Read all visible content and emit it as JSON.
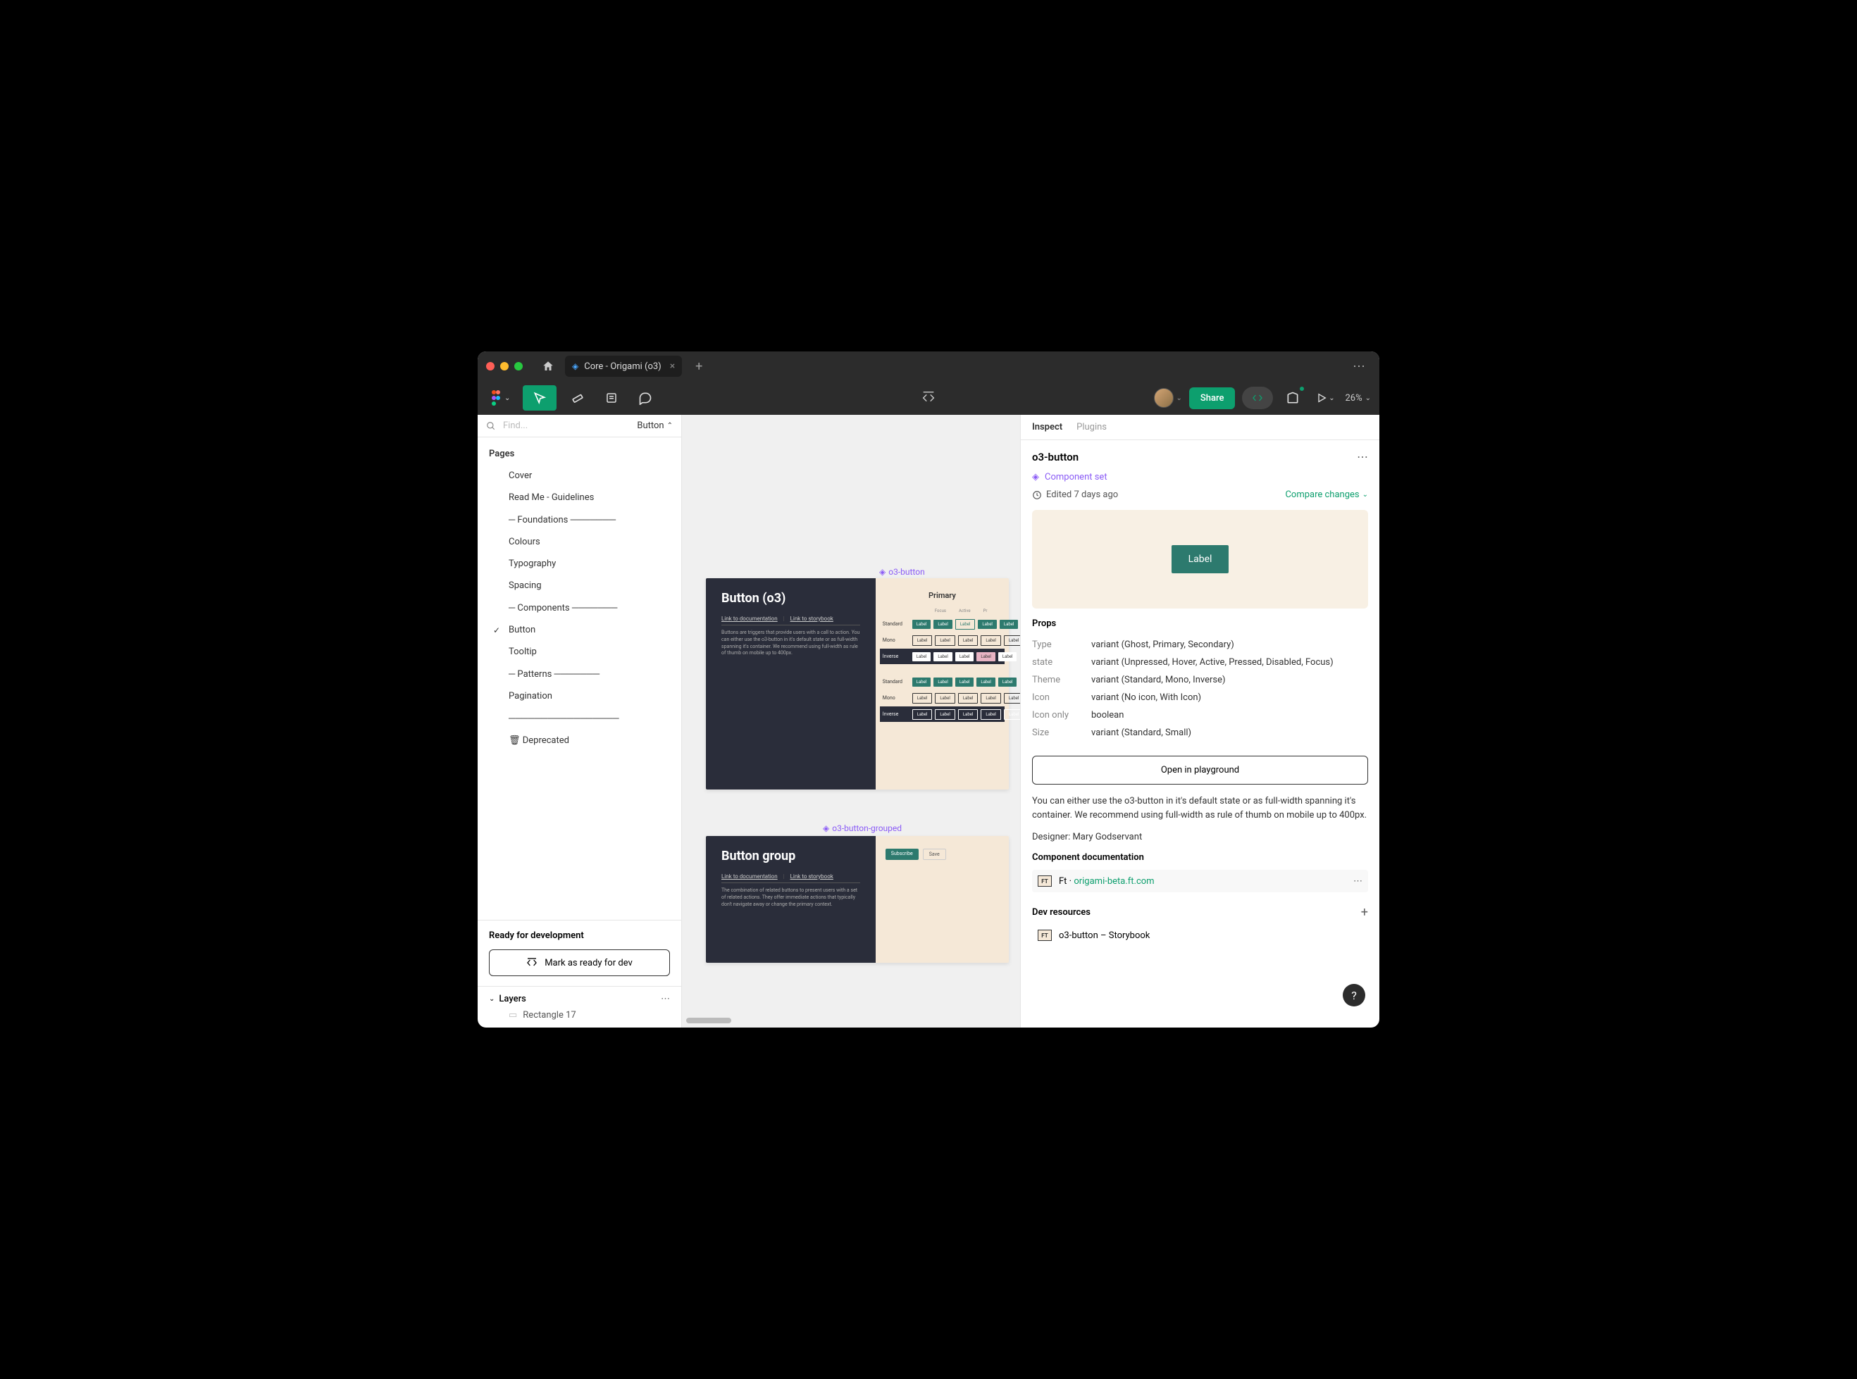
{
  "tab": {
    "title": "Core - Origami (o3)"
  },
  "toolbar": {
    "share": "Share",
    "zoom": "26%"
  },
  "search": {
    "placeholder": "Find...",
    "filter": "Button"
  },
  "pages": {
    "title": "Pages",
    "items": [
      "Cover",
      "Read Me - Guidelines",
      "─ Foundations ───────",
      "Colours",
      "Typography",
      "Spacing",
      "─ Components ───────",
      "Button",
      "Tooltip",
      "─ Patterns ───────",
      "Pagination",
      "─────────────────",
      "🗑 Deprecated"
    ],
    "selected_index": 7
  },
  "ready": {
    "title": "Ready for development",
    "button": "Mark as ready for dev"
  },
  "layers": {
    "title": "Layers",
    "item": "Rectangle 17"
  },
  "canvas": {
    "frame1": {
      "title": "Button (o3)",
      "link1": "Link to documentation",
      "link2": "Link to storybook",
      "desc": "Buttons are triggers that provide users with a call to action. You can either use the o3-button in it's default state or as full-width spanning it's container. We recommend using full-width as rule of thumb on mobile up to 400px.",
      "variant_title": "Primary",
      "selection_label": "o3-button",
      "col_headers": [
        "Focus",
        "Active",
        "Pr"
      ],
      "rows": [
        "Standard",
        "Mono",
        "Inverse",
        "Standard",
        "Mono",
        "Inverse"
      ],
      "btn_label": "Label"
    },
    "frame2": {
      "title": "Button group",
      "link1": "Link to documentation",
      "link2": "Link to storybook",
      "desc": "The combination of related buttons to present users with a set of related actions. They offer immediate actions that typically don't navigate away or change the primary context.",
      "selection_label": "o3-button-grouped",
      "pill1": "Subscribe",
      "pill2": "Save"
    }
  },
  "inspect": {
    "tabs": [
      "Inspect",
      "Plugins"
    ],
    "component_name": "o3-button",
    "component_type": "Component set",
    "edited": "Edited 7 days ago",
    "compare": "Compare changes",
    "preview_label": "Label",
    "props_title": "Props",
    "props": [
      {
        "k": "Type",
        "v": "variant (Ghost, Primary, Secondary)"
      },
      {
        "k": "state",
        "v": "variant (Unpressed, Hover, Active, Pressed, Disabled, Focus)"
      },
      {
        "k": "Theme",
        "v": "variant (Standard, Mono, Inverse)"
      },
      {
        "k": "Icon",
        "v": "variant (No icon, With Icon)"
      },
      {
        "k": "Icon only",
        "v": "boolean"
      },
      {
        "k": "Size",
        "v": "variant (Standard, Small)"
      }
    ],
    "playground": "Open in playground",
    "description": "You can either use the o3-button in it's default state or as full-width spanning it's container. We recommend using full-width as rule of thumb on mobile up to 400px.",
    "designer": "Designer: Mary Godservant",
    "doc_title": "Component documentation",
    "doc_link_label": "Ft",
    "doc_link_sep": " · ",
    "doc_link_url": "origami-beta.ft.com",
    "dev_res_title": "Dev resources",
    "dev_res_item": "o3-button – Storybook"
  }
}
